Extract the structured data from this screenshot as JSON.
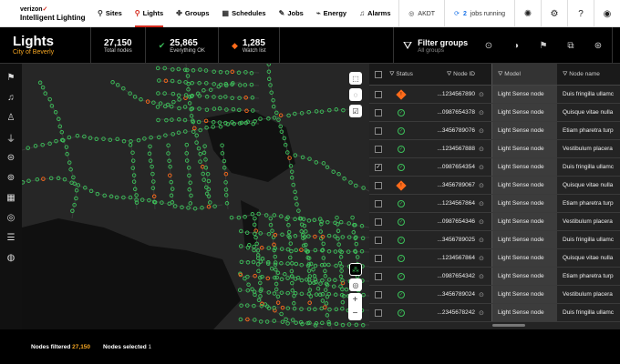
{
  "brand": {
    "company": "verizon",
    "product": "Intelligent Lighting"
  },
  "nav": [
    {
      "label": "Sites",
      "icon": "sites-icon",
      "glyph": "⚲"
    },
    {
      "label": "Lights",
      "icon": "pin-icon",
      "glyph": "⚲",
      "active": true
    },
    {
      "label": "Groups",
      "icon": "groups-icon",
      "glyph": "✤"
    },
    {
      "label": "Schedules",
      "icon": "calendar-icon",
      "glyph": "▦"
    },
    {
      "label": "Jobs",
      "icon": "wrench-icon",
      "glyph": "✎"
    },
    {
      "label": "Energy",
      "icon": "energy-icon",
      "glyph": "⌁"
    },
    {
      "label": "Alarms",
      "icon": "bell-icon",
      "glyph": "♫"
    }
  ],
  "topbar": {
    "timezone": "AKDT",
    "jobs_count": "2",
    "jobs_label": "jobs running"
  },
  "header": {
    "title": "Lights",
    "subtitle": "City of Beverly",
    "stats": [
      {
        "num": "27,150",
        "label": "Total nodes"
      },
      {
        "num": "25,865",
        "label": "Everything OK",
        "icon": "check-circle-icon",
        "color": "#3cc15a"
      },
      {
        "num": "1,285",
        "label": "Watch list",
        "icon": "warning-icon",
        "color": "#ff6b1a"
      }
    ],
    "filter_title": "Filter groups",
    "filter_sub": "All groups"
  },
  "table": {
    "columns": {
      "status": "Status",
      "node_id": "Node ID",
      "model": "Model",
      "name": "Node name"
    },
    "rows": [
      {
        "status": "warn",
        "id": "...1234567890",
        "model": "Light Sense node",
        "name": "Duis fringilla ullamc",
        "checked": false
      },
      {
        "status": "ok",
        "id": "...0987654378",
        "model": "Light Sense node",
        "name": "Quisque vitae nulla",
        "checked": false
      },
      {
        "status": "ok",
        "id": "...3456789076",
        "model": "Light Sense node",
        "name": "Etiam pharetra turp",
        "checked": false
      },
      {
        "status": "ok",
        "id": "...1234567888",
        "model": "Light Sense node",
        "name": "Vestibulum placera",
        "checked": false
      },
      {
        "status": "ok",
        "id": "...0987654354",
        "model": "Light Sense node",
        "name": "Duis fringilla ullamc",
        "checked": true
      },
      {
        "status": "warn",
        "id": "...3456789067",
        "model": "Light Sense node",
        "name": "Quisque vitae nulla",
        "checked": false
      },
      {
        "status": "ok",
        "id": "...1234567864",
        "model": "Light Sense node",
        "name": "Etiam pharetra turp",
        "checked": false
      },
      {
        "status": "ok",
        "id": "...0987654346",
        "model": "Light Sense node",
        "name": "Vestibulum placera",
        "checked": false
      },
      {
        "status": "ok",
        "id": "...3456789025",
        "model": "Light Sense node",
        "name": "Duis fringilla ullamc",
        "checked": false
      },
      {
        "status": "ok",
        "id": "...1234567864",
        "model": "Light Sense node",
        "name": "Quisque vitae nulla",
        "checked": false
      },
      {
        "status": "ok",
        "id": "...0987654342",
        "model": "Light Sense node",
        "name": "Etiam pharetra turp",
        "checked": false
      },
      {
        "status": "ok",
        "id": "...3456789024",
        "model": "Light Sense node",
        "name": "Vestibulum placera",
        "checked": false
      },
      {
        "status": "ok",
        "id": "...2345678242",
        "model": "Light Sense node",
        "name": "Duis fringilla ullamc",
        "checked": false
      }
    ]
  },
  "footer": {
    "filtered_label": "Nodes filtered",
    "filtered_value": "27,150",
    "selected_label": "Nodes selected",
    "selected_value": "1"
  },
  "colors": {
    "ok": "#3cc15a",
    "warn": "#ff6b1a",
    "brand_red": "#d52b1e",
    "accent": "#f5a623"
  }
}
